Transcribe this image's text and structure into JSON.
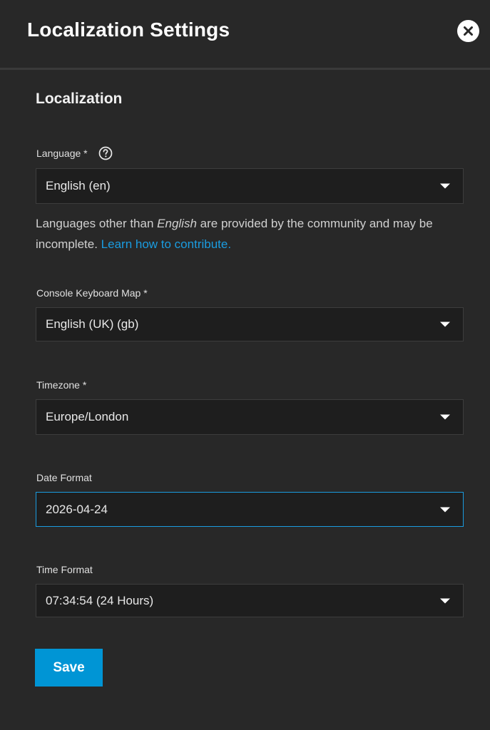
{
  "header": {
    "title": "Localization Settings",
    "close_icon": "close-circle-icon"
  },
  "section": {
    "title": "Localization"
  },
  "fields": {
    "language": {
      "label": "Language *",
      "value": "English (en)",
      "help_icon": "question-circle-icon"
    },
    "keyboard_map": {
      "label": "Console Keyboard Map *",
      "value": "English (UK) (gb)"
    },
    "timezone": {
      "label": "Timezone *",
      "value": "Europe/London"
    },
    "date_format": {
      "label": "Date Format",
      "value": "2026-04-24"
    },
    "time_format": {
      "label": "Time Format",
      "value": "07:34:54 (24 Hours)"
    }
  },
  "hint": {
    "text_before": "Languages other than ",
    "emphasis": "English",
    "text_after": " are provided by the community and may be incomplete. ",
    "link_text": "Learn how to contribute."
  },
  "actions": {
    "save_label": "Save"
  },
  "colors": {
    "background": "#282828",
    "field_background": "#1e1e1e",
    "accent": "#0095d5",
    "link": "#1a9ce0"
  }
}
